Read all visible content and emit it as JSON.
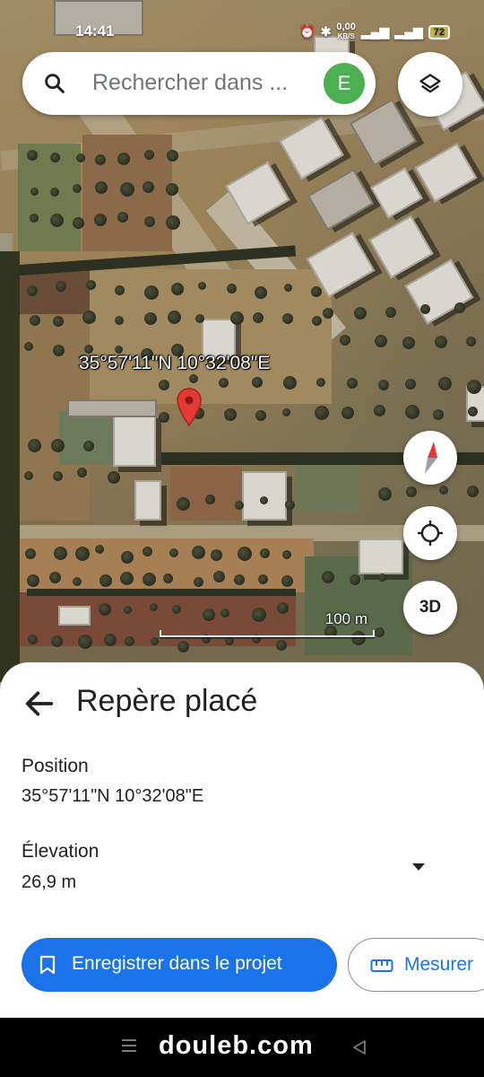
{
  "status_bar": {
    "time": "14:41",
    "speed": "0,00",
    "speed_unit": "KB/S",
    "battery": "72"
  },
  "search": {
    "placeholder": "Rechercher dans ...",
    "avatar_letter": "E"
  },
  "map": {
    "coordinate_label": "35°57'11\"N 10°32'08\"E",
    "scale_label": "100 m",
    "view3d_label": "3D",
    "pin_color": "#e53935"
  },
  "sheet": {
    "title": "Repère placé",
    "position_label": "Position",
    "position_value": "35°57'11\"N 10°32'08\"E",
    "elevation_label": "Élevation",
    "elevation_value": "26,9 m",
    "save_label": "Enregistrer dans le projet",
    "measure_label": "Mesurer"
  },
  "colors": {
    "accent": "#1a73e8",
    "avatar": "#4caf50"
  },
  "nav_bar": {
    "watermark": "douleb.com"
  },
  "icons": [
    "search-icon",
    "layers-icon",
    "location-pin-icon",
    "compass-icon",
    "my-location-icon",
    "back-arrow-icon",
    "dropdown-arrow-icon",
    "bookmark-icon",
    "ruler-icon",
    "nav-menu-icon",
    "nav-back-icon"
  ]
}
